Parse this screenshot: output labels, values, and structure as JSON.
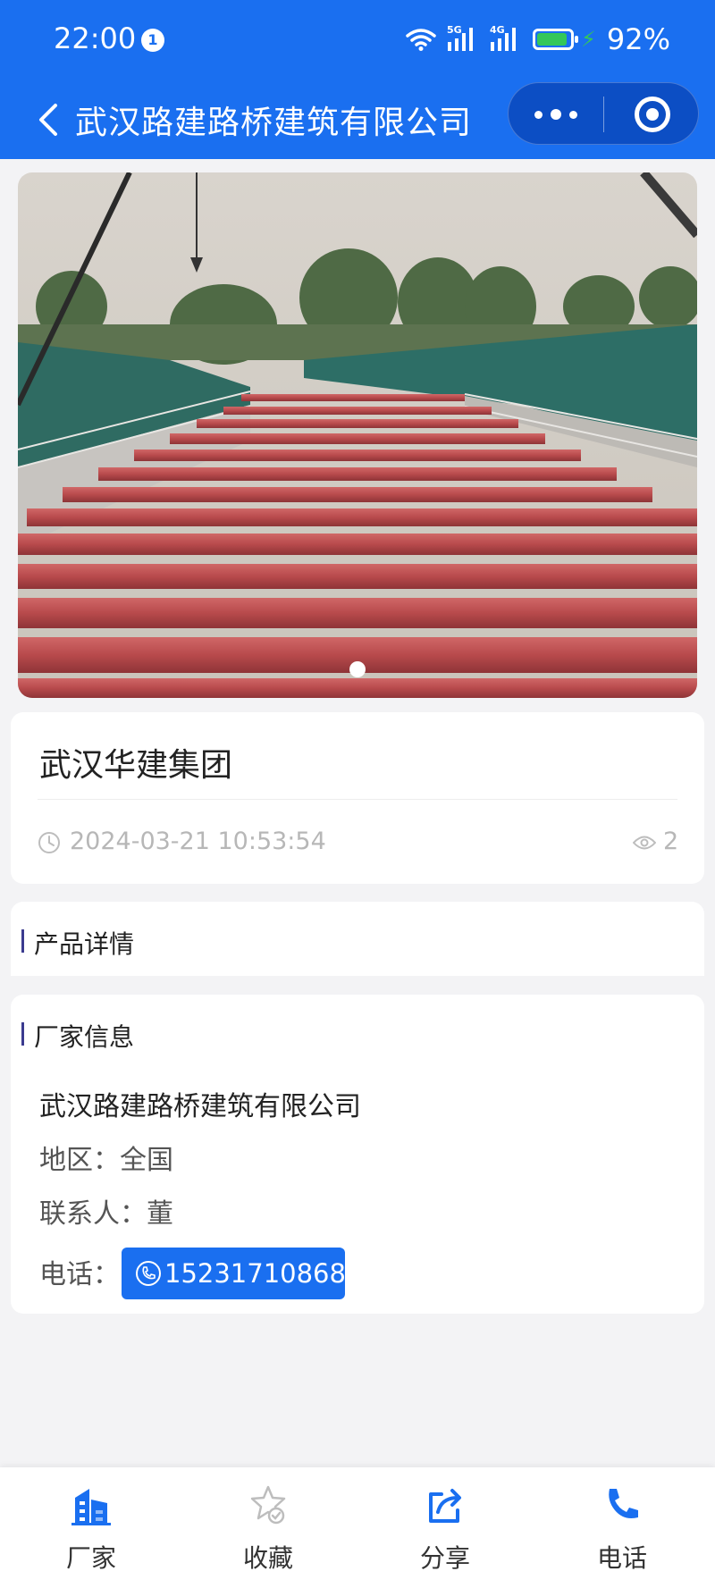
{
  "status_bar": {
    "time": "22:00",
    "notification_count": "1",
    "network_1": "5G",
    "network_2": "4G",
    "battery_percent": "92%",
    "battery_level": 0.92
  },
  "navbar": {
    "title": "武汉路建路桥建筑有限公司"
  },
  "banner": {
    "image": "red-steel-pipes-construction-site",
    "slide_count": 1,
    "active_slide": 1
  },
  "product": {
    "title": "武汉华建集团",
    "publish_time": "2024-03-21 10:53:54",
    "views": "2"
  },
  "detail_section": {
    "heading": "产品详情"
  },
  "maker_section": {
    "heading": "厂家信息",
    "company": "武汉路建路桥建筑有限公司",
    "region_label": "地区：",
    "region_value": "全国",
    "contact_label": "联系人：",
    "contact_value": "董",
    "phone_label": "电话：",
    "phone_value": "15231710868"
  },
  "bottom_nav": {
    "tabs": [
      {
        "label": "厂家",
        "icon": "building-icon"
      },
      {
        "label": "收藏",
        "icon": "star-icon"
      },
      {
        "label": "分享",
        "icon": "share-icon"
      },
      {
        "label": "电话",
        "icon": "phone-icon"
      }
    ]
  },
  "colors": {
    "primary": "#1a6ff0",
    "background": "#f3f3f5",
    "muted_text": "#b7b7b7"
  }
}
